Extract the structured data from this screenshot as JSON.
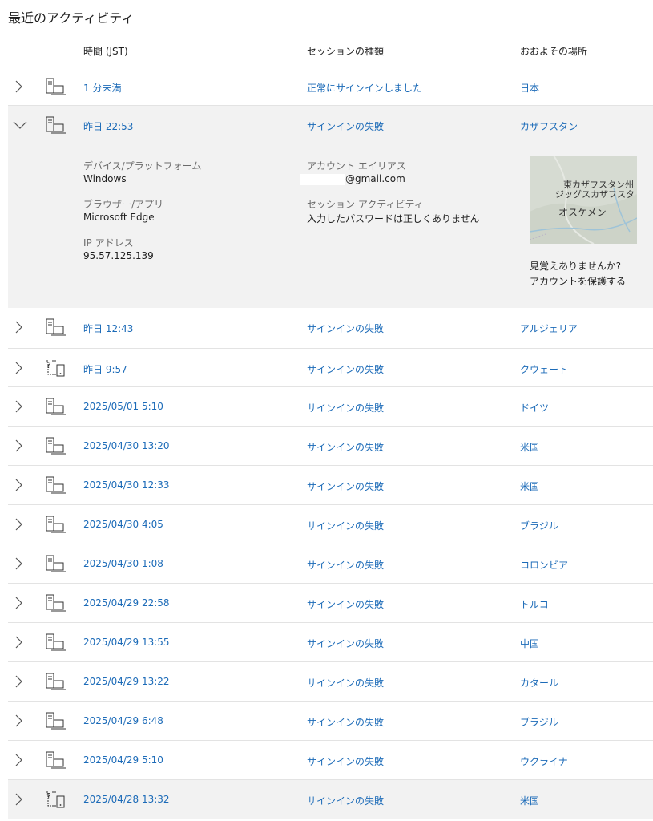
{
  "page_title": "最近のアクティビティ",
  "header": {
    "time": "時間 (JST)",
    "session": "セッションの種類",
    "location": "おおよその場所"
  },
  "rows": [
    {
      "time": "1 分未満",
      "session": "正常にサインインしました",
      "location": "日本",
      "device": "desktop-icon",
      "expanded": false
    },
    {
      "time": "昨日 22:53",
      "session": "サインインの失敗",
      "location": "カザフスタン",
      "device": "desktop-icon",
      "expanded": true
    },
    {
      "time": "昨日 12:43",
      "session": "サインインの失敗",
      "location": "アルジェリア",
      "device": "desktop-icon",
      "expanded": false
    },
    {
      "time": "昨日 9:57",
      "session": "サインインの失敗",
      "location": "クウェート",
      "device": "unknown-device-icon",
      "expanded": false
    },
    {
      "time": "2025/05/01 5:10",
      "session": "サインインの失敗",
      "location": "ドイツ",
      "device": "desktop-icon",
      "expanded": false
    },
    {
      "time": "2025/04/30 13:20",
      "session": "サインインの失敗",
      "location": "米国",
      "device": "desktop-icon",
      "expanded": false
    },
    {
      "time": "2025/04/30 12:33",
      "session": "サインインの失敗",
      "location": "米国",
      "device": "desktop-icon",
      "expanded": false
    },
    {
      "time": "2025/04/30 4:05",
      "session": "サインインの失敗",
      "location": "ブラジル",
      "device": "desktop-icon",
      "expanded": false
    },
    {
      "time": "2025/04/30 1:08",
      "session": "サインインの失敗",
      "location": "コロンビア",
      "device": "desktop-icon",
      "expanded": false
    },
    {
      "time": "2025/04/29 22:58",
      "session": "サインインの失敗",
      "location": "トルコ",
      "device": "desktop-icon",
      "expanded": false
    },
    {
      "time": "2025/04/29 13:55",
      "session": "サインインの失敗",
      "location": "中国",
      "device": "desktop-icon",
      "expanded": false
    },
    {
      "time": "2025/04/29 13:22",
      "session": "サインインの失敗",
      "location": "カタール",
      "device": "desktop-icon",
      "expanded": false
    },
    {
      "time": "2025/04/29 6:48",
      "session": "サインインの失敗",
      "location": "ブラジル",
      "device": "desktop-icon",
      "expanded": false
    },
    {
      "time": "2025/04/29 5:10",
      "session": "サインインの失敗",
      "location": "ウクライナ",
      "device": "desktop-icon",
      "expanded": false
    },
    {
      "time": "2025/04/28 13:32",
      "session": "サインインの失敗",
      "location": "米国",
      "device": "unknown-device-icon",
      "expanded": false
    }
  ],
  "detail": {
    "device_label": "デバイス/プラットフォーム",
    "device_value": "Windows",
    "browser_label": "ブラウザー/アプリ",
    "browser_value": "Microsoft Edge",
    "ip_label": "IP アドレス",
    "ip_value": "95.57.125.139",
    "alias_label": "アカウント エイリアス",
    "alias_value": "@gmail.com",
    "activity_label": "セッション アクティビティ",
    "activity_value": "入力したパスワードは正しくありません",
    "map_label_1": "東カザフスタン州",
    "map_label_2": "ジッグスカザフスタ",
    "map_city": "オスケメン",
    "unfamiliar": "見覚えありませんか?",
    "protect_link": "アカウントを保護する"
  },
  "colors": {
    "link": "#1c6bb8",
    "highlight": "#f2f2f2",
    "divider": "#e3e3e3"
  }
}
